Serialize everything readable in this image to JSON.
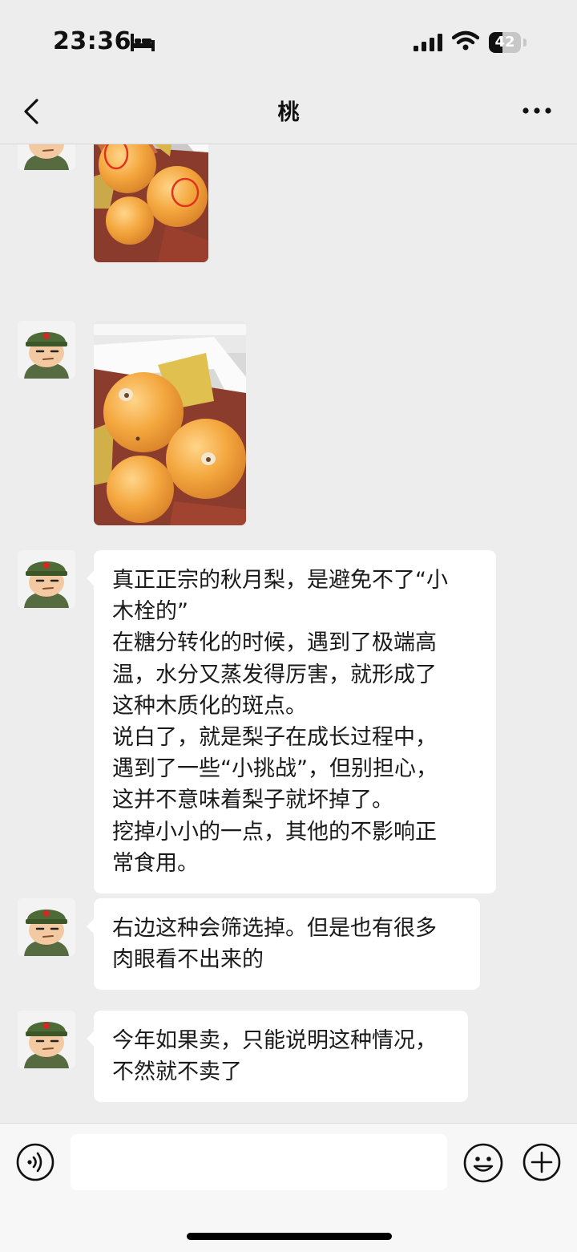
{
  "status_bar": {
    "time": "23:36",
    "battery_level": "42"
  },
  "nav": {
    "title": "桃"
  },
  "messages": [
    {
      "type": "image",
      "sender": "contact",
      "content": "梨子照片（红圈标记斑点）"
    },
    {
      "type": "image",
      "sender": "contact",
      "content": "梨子照片（木栓斑点）"
    },
    {
      "type": "text",
      "sender": "contact",
      "text": "真正正宗的秋月梨，是避免不了“小\n木栓的”\n在糖分转化的时候，遇到了极端高\n温，水分又蒸发得厉害，就形成了\n这种木质化的斑点。\n说白了，就是梨子在成长过程中，\n遇到了一些“小挑战”，但别担心，\n这并不意味着梨子就坏掉了。\n挖掉小小的一点，其他的不影响正\n常食用。"
    },
    {
      "type": "text",
      "sender": "contact",
      "text": "右边这种会筛选掉。但是也有很多\n肉眼看不出来的"
    },
    {
      "type": "text",
      "sender": "contact",
      "text": "今年如果卖，只能说明这种情况，\n不然就不卖了"
    }
  ],
  "input_bar": {
    "placeholder": ""
  },
  "colors": {
    "background": "#ededed",
    "bubble": "#ffffff",
    "pear": "#f2a23a",
    "marker": "#e0321f"
  }
}
